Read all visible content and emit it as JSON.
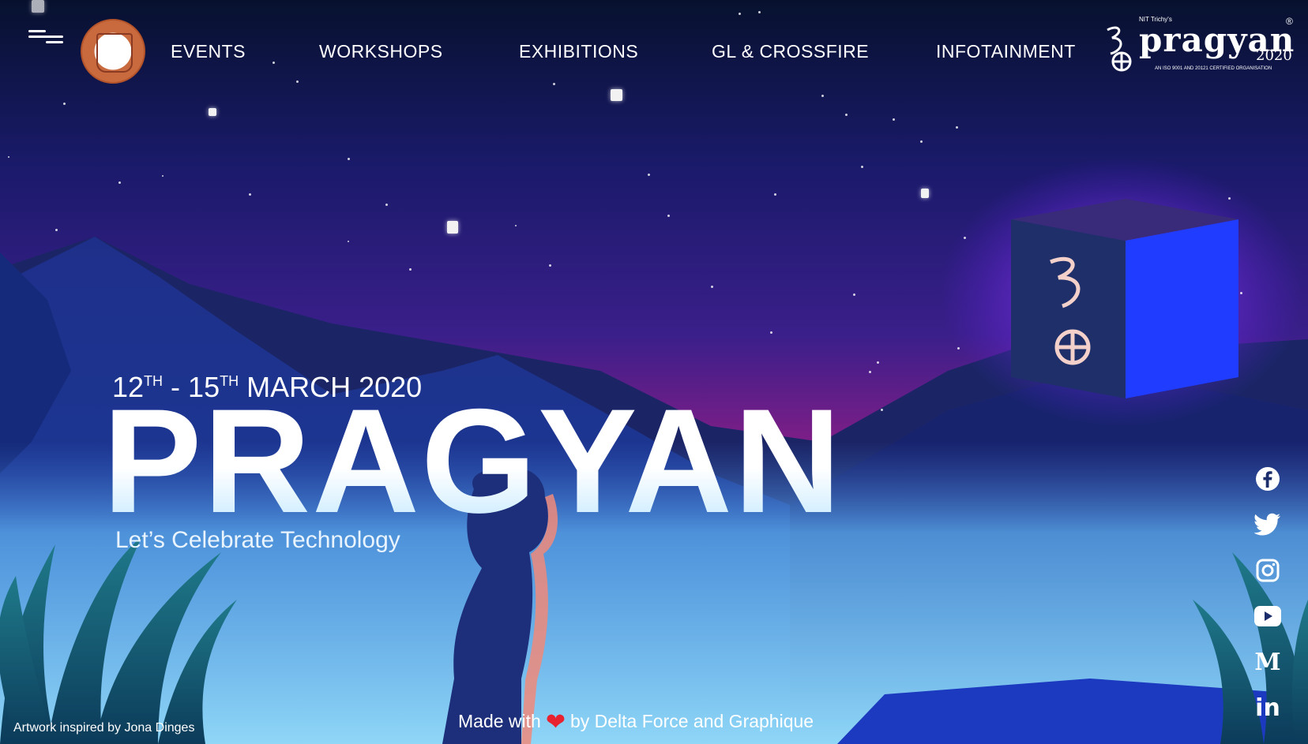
{
  "nav": {
    "menu_icon": "hamburger-menu-icon",
    "college_logo": "nit-trichy-emblem",
    "items": [
      {
        "label": "EVENTS"
      },
      {
        "label": "WORKSHOPS"
      },
      {
        "label": "EXHIBITIONS"
      },
      {
        "label": "GL & CROSSFIRE"
      },
      {
        "label": "INFOTAINMENT"
      }
    ]
  },
  "brand": {
    "prefix": "NIT Trichy's",
    "name": "pragyan",
    "year": "2020",
    "registered": "®",
    "certification": "AN ISO 9001 AND 20121 CERTIFIED ORGANISATION"
  },
  "hero": {
    "dates": {
      "start_day": "12",
      "start_suffix": "TH",
      "separator": " - ",
      "end_day": "15",
      "end_suffix": "TH",
      "month_year": " MARCH 2020"
    },
    "title": "PRAGYAN",
    "tagline": "Let’s Celebrate Technology"
  },
  "social": [
    {
      "name": "facebook-icon"
    },
    {
      "name": "twitter-icon"
    },
    {
      "name": "instagram-icon"
    },
    {
      "name": "youtube-icon"
    },
    {
      "name": "medium-icon",
      "glyph": "M"
    },
    {
      "name": "linkedin-icon",
      "glyph": "in"
    }
  ],
  "footer": {
    "credit": "Artwork inspired by Jona Dinges",
    "made_prefix": "Made with",
    "made_suffix": "by Delta Force and Graphique"
  },
  "colors": {
    "sky_top": "#07112e",
    "sky_mid": "#3a1f8a",
    "horizon_magenta": "#8a1d86",
    "mist_blue": "#7fcdf4",
    "cube_glow": "#8a3cff",
    "cube_face": "#1a3cff",
    "heart": "#e8222e"
  }
}
